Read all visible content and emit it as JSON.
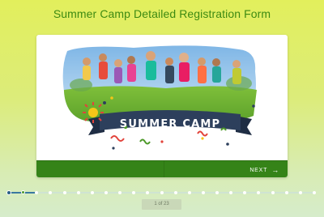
{
  "form": {
    "title": "Summer Camp Detailed Registration Form"
  },
  "banner": {
    "text": "SUMMER CAMP"
  },
  "navigation": {
    "next_label": "NEXT",
    "next_icon": "arrow-right-icon"
  },
  "progress": {
    "total_steps": 23,
    "current_step": 1,
    "page_label": "1 of 23"
  },
  "colors": {
    "title": "#3d8a12",
    "footer": "#358318",
    "banner": "#2d3f5c",
    "accent": "#f5c518"
  }
}
